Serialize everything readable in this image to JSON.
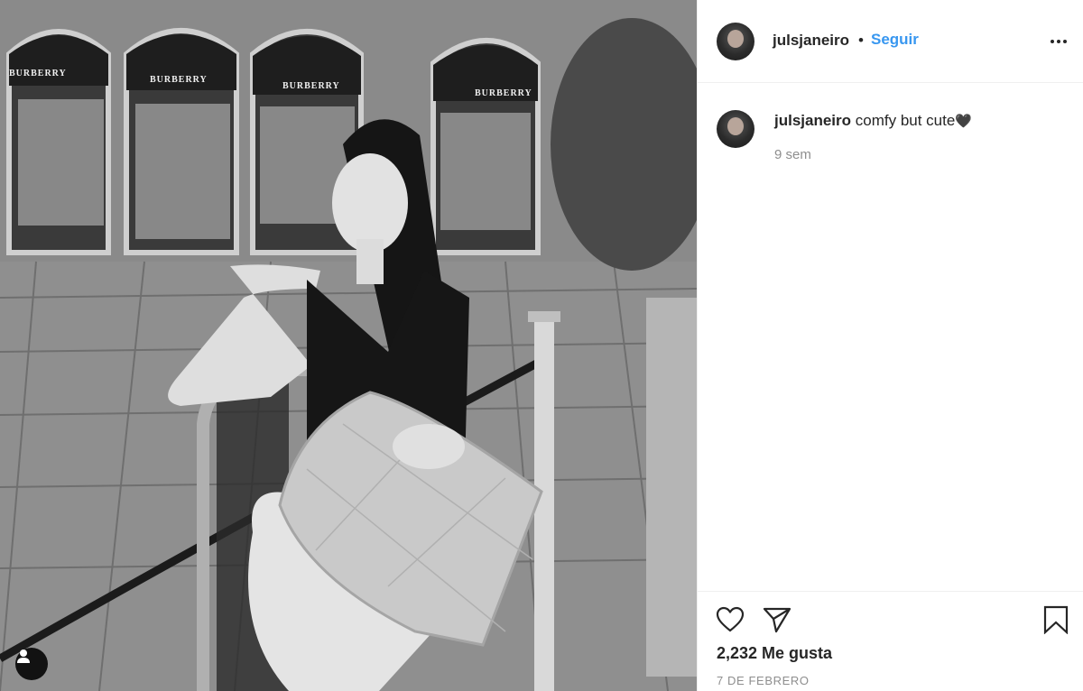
{
  "photo": {
    "store_signs": [
      "BURBERRY",
      "BURBERRY",
      "BURBERRY",
      "BURBERRY"
    ]
  },
  "header": {
    "username": "julsjaneiro",
    "separator": "•",
    "follow_label": "Seguir"
  },
  "caption": {
    "username": "julsjaneiro",
    "text": "comfy but cute",
    "emoji": "🖤",
    "time": "9 sem"
  },
  "actions": {
    "likes": "2,232 Me gusta",
    "date": "7 DE FEBRERO"
  },
  "colors": {
    "accent": "#3897f0",
    "text": "#262626",
    "muted": "#8e8e8e",
    "divider": "#efefef"
  },
  "icons": {
    "like": "heart-outline-icon",
    "share": "paper-plane-icon",
    "save": "bookmark-outline-icon",
    "more": "ellipsis-icon",
    "user_tag": "person-icon"
  }
}
